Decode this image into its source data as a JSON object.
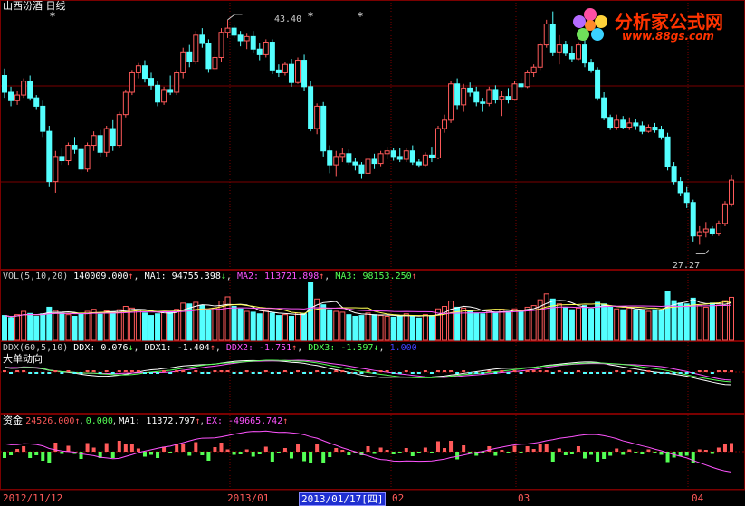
{
  "title": "山西汾酒 日线",
  "price_panel": {
    "high_label": "43.40",
    "low_label": "27.27",
    "star": "*"
  },
  "logo": {
    "name": "分析家公式网",
    "url": "www.88gs.com"
  },
  "vol_header": {
    "name": "VOL(5,10,20)",
    "value": "140009.000",
    "ma1": "MA1: 94755.398",
    "ma2": "MA2: 113721.898",
    "ma3": "MA3: 98153.250",
    "arrow_up": "↑",
    "arrow_down": "↓"
  },
  "ddx_header": {
    "name": "DDX(60,5,10)",
    "ddx": "DDX: 0.076",
    "ddx1": "DDX1: -1.404",
    "ddx2": "DDX2: -1.751",
    "ddx3": "DDX3: -1.597",
    "extra": "1.000",
    "subtitle": "大单动向"
  },
  "fund_header": {
    "name": "资金",
    "value": "24526.000",
    "zero": "0.000",
    "ma1": "MA1: 11372.797",
    "ex": "EX: -49665.742"
  },
  "dates": {
    "d1": "2012/11/12",
    "d2": "2013/01",
    "cursor": "2013/01/17",
    "cursor_weekday": "四",
    "d4": "02",
    "d5": "03",
    "d6": "04"
  },
  "colors": {
    "up": "#ff5a5a",
    "down": "#54ffff",
    "grid": "#7a0000",
    "white": "#ffffff",
    "yellow": "#ffff54",
    "magenta": "#ff54ff",
    "green": "#54ff54",
    "blue": "#4040ff"
  },
  "chart_data": {
    "type": "candlestick",
    "ohlc": [
      [
        39.4,
        39.9,
        37.8,
        38.2
      ],
      [
        38.2,
        38.6,
        37.2,
        37.6
      ],
      [
        37.6,
        38.3,
        37.3,
        38.0
      ],
      [
        38.0,
        39.2,
        37.8,
        39.0
      ],
      [
        39.0,
        39.4,
        37.6,
        37.8
      ],
      [
        37.8,
        38.0,
        37.0,
        37.2
      ],
      [
        37.2,
        37.6,
        35.0,
        35.4
      ],
      [
        35.4,
        35.8,
        31.4,
        31.8
      ],
      [
        31.8,
        34.0,
        31.0,
        33.6
      ],
      [
        33.6,
        34.2,
        33.0,
        33.3
      ],
      [
        33.3,
        34.6,
        33.0,
        34.4
      ],
      [
        34.4,
        35.0,
        33.8,
        34.1
      ],
      [
        34.1,
        34.5,
        32.4,
        32.7
      ],
      [
        32.7,
        34.6,
        32.5,
        34.4
      ],
      [
        34.4,
        35.4,
        34.0,
        35.1
      ],
      [
        35.1,
        35.5,
        33.6,
        33.9
      ],
      [
        33.9,
        35.8,
        33.6,
        35.6
      ],
      [
        35.6,
        36.2,
        34.0,
        34.4
      ],
      [
        34.4,
        36.8,
        34.2,
        36.6
      ],
      [
        36.6,
        38.4,
        36.4,
        38.2
      ],
      [
        38.2,
        39.8,
        38.0,
        39.6
      ],
      [
        39.6,
        40.3,
        39.2,
        40.1
      ],
      [
        40.1,
        40.5,
        38.9,
        39.2
      ],
      [
        39.2,
        39.6,
        38.4,
        38.7
      ],
      [
        38.7,
        39.0,
        37.2,
        37.5
      ],
      [
        37.5,
        38.6,
        37.3,
        38.4
      ],
      [
        38.4,
        39.4,
        38.0,
        38.2
      ],
      [
        38.2,
        39.8,
        38.0,
        39.6
      ],
      [
        39.6,
        41.4,
        39.2,
        41.1
      ],
      [
        41.1,
        41.6,
        40.0,
        40.4
      ],
      [
        40.4,
        42.6,
        40.2,
        42.3
      ],
      [
        42.3,
        42.8,
        41.4,
        41.7
      ],
      [
        41.7,
        42.0,
        39.6,
        39.9
      ],
      [
        39.9,
        41.2,
        39.8,
        40.7
      ],
      [
        40.7,
        42.8,
        40.4,
        42.5
      ],
      [
        42.5,
        43.4,
        42.1,
        42.8
      ],
      [
        42.8,
        43.0,
        42.1,
        42.3
      ],
      [
        42.3,
        42.6,
        41.5,
        41.9
      ],
      [
        41.9,
        42.4,
        41.3,
        42.2
      ],
      [
        42.2,
        42.6,
        41.0,
        41.3
      ],
      [
        41.3,
        41.7,
        40.5,
        40.9
      ],
      [
        40.9,
        42.0,
        40.7,
        41.8
      ],
      [
        41.8,
        42.0,
        39.5,
        39.8
      ],
      [
        39.8,
        40.2,
        39.3,
        39.6
      ],
      [
        39.6,
        40.4,
        39.4,
        40.2
      ],
      [
        40.2,
        40.6,
        38.6,
        38.9
      ],
      [
        38.9,
        40.7,
        38.8,
        40.5
      ],
      [
        40.5,
        40.9,
        38.3,
        38.6
      ],
      [
        38.6,
        39.0,
        35.4,
        35.6
      ],
      [
        35.6,
        37.4,
        35.2,
        37.2
      ],
      [
        37.2,
        37.5,
        33.6,
        34.0
      ],
      [
        34.0,
        34.4,
        32.4,
        33.0
      ],
      [
        33.0,
        34.0,
        32.2,
        33.6
      ],
      [
        33.6,
        34.2,
        33.2,
        33.8
      ],
      [
        33.8,
        34.1,
        33.0,
        33.2
      ],
      [
        33.2,
        33.5,
        32.6,
        33.0
      ],
      [
        33.0,
        33.2,
        32.0,
        32.4
      ],
      [
        32.4,
        33.6,
        32.2,
        33.4
      ],
      [
        33.4,
        33.8,
        32.7,
        33.1
      ],
      [
        33.1,
        34.0,
        32.9,
        33.8
      ],
      [
        33.8,
        34.3,
        33.4,
        34.0
      ],
      [
        34.0,
        34.2,
        33.3,
        33.6
      ],
      [
        33.6,
        34.2,
        33.2,
        33.4
      ],
      [
        33.4,
        34.2,
        33.2,
        34.0
      ],
      [
        34.0,
        34.4,
        33.0,
        33.2
      ],
      [
        33.2,
        33.4,
        32.8,
        33.0
      ],
      [
        33.0,
        33.9,
        32.9,
        33.7
      ],
      [
        33.7,
        34.3,
        33.2,
        33.5
      ],
      [
        33.5,
        35.8,
        33.4,
        35.6
      ],
      [
        35.6,
        36.6,
        35.3,
        36.2
      ],
      [
        36.2,
        39.0,
        36.0,
        38.8
      ],
      [
        38.8,
        39.2,
        37.0,
        37.3
      ],
      [
        37.3,
        38.8,
        36.8,
        38.5
      ],
      [
        38.5,
        38.9,
        37.9,
        38.2
      ],
      [
        38.2,
        38.6,
        37.2,
        37.5
      ],
      [
        37.5,
        37.8,
        36.8,
        37.4
      ],
      [
        37.4,
        38.6,
        37.2,
        38.4
      ],
      [
        38.4,
        38.7,
        37.4,
        37.7
      ],
      [
        37.7,
        38.3,
        36.5,
        37.9
      ],
      [
        37.9,
        38.5,
        37.4,
        37.7
      ],
      [
        37.7,
        39.0,
        37.6,
        38.8
      ],
      [
        38.8,
        39.2,
        38.4,
        38.6
      ],
      [
        38.6,
        39.8,
        38.5,
        39.6
      ],
      [
        39.6,
        40.2,
        39.3,
        40.0
      ],
      [
        40.0,
        41.8,
        39.8,
        41.6
      ],
      [
        41.6,
        43.4,
        41.4,
        43.1
      ],
      [
        43.1,
        44.0,
        40.8,
        41.1
      ],
      [
        41.1,
        42.3,
        40.2,
        41.6
      ],
      [
        41.6,
        41.9,
        40.8,
        41.0
      ],
      [
        41.0,
        41.5,
        40.4,
        40.6
      ],
      [
        40.6,
        41.8,
        40.5,
        41.6
      ],
      [
        41.6,
        42.0,
        40.0,
        40.3
      ],
      [
        40.3,
        40.6,
        39.6,
        39.8
      ],
      [
        39.8,
        40.0,
        37.6,
        37.8
      ],
      [
        37.8,
        38.2,
        36.2,
        36.4
      ],
      [
        36.4,
        36.6,
        35.5,
        35.7
      ],
      [
        35.7,
        36.6,
        35.5,
        36.2
      ],
      [
        36.2,
        36.5,
        35.6,
        35.7
      ],
      [
        35.7,
        36.4,
        35.5,
        36.0
      ],
      [
        36.0,
        36.3,
        35.5,
        35.8
      ],
      [
        35.8,
        36.1,
        35.2,
        35.4
      ],
      [
        35.4,
        35.9,
        35.3,
        35.7
      ],
      [
        35.7,
        36.0,
        35.3,
        35.5
      ],
      [
        35.5,
        35.8,
        34.8,
        35.0
      ],
      [
        35.0,
        35.3,
        32.6,
        32.9
      ],
      [
        32.9,
        33.2,
        31.6,
        31.8
      ],
      [
        31.8,
        32.1,
        30.8,
        31.0
      ],
      [
        31.0,
        31.4,
        29.9,
        30.3
      ],
      [
        30.3,
        30.5,
        27.5,
        27.9
      ],
      [
        27.9,
        28.6,
        27.27,
        28.2
      ],
      [
        28.2,
        28.9,
        27.8,
        28.4
      ],
      [
        28.4,
        28.6,
        27.9,
        28.1
      ],
      [
        28.1,
        29.0,
        27.9,
        28.8
      ],
      [
        28.8,
        30.4,
        28.6,
        30.2
      ],
      [
        30.2,
        32.3,
        30.0,
        31.9
      ]
    ],
    "volume": [
      60,
      55,
      62,
      70,
      65,
      58,
      64,
      80,
      72,
      66,
      62,
      58,
      65,
      70,
      75,
      63,
      71,
      68,
      74,
      82,
      78,
      72,
      66,
      60,
      64,
      70,
      68,
      75,
      90,
      88,
      92,
      85,
      72,
      78,
      95,
      105,
      82,
      76,
      70,
      68,
      64,
      72,
      66,
      60,
      62,
      58,
      66,
      64,
      140,
      100,
      86,
      74,
      70,
      68,
      62,
      58,
      60,
      66,
      62,
      60,
      58,
      56,
      60,
      64,
      58,
      54,
      62,
      60,
      76,
      82,
      95,
      80,
      78,
      70,
      66,
      64,
      72,
      68,
      75,
      70,
      76,
      72,
      80,
      84,
      98,
      112,
      100,
      88,
      80,
      74,
      78,
      84,
      76,
      92,
      88,
      80,
      76,
      74,
      78,
      74,
      72,
      70,
      74,
      72,
      118,
      96,
      90,
      88,
      102,
      84,
      80,
      90,
      85,
      96,
      104
    ],
    "vol_ma": [
      {
        "name": "MA1",
        "color": "#ffffff"
      },
      {
        "name": "MA2",
        "color": "#ffff54"
      },
      {
        "name": "MA3",
        "color": "#ff54ff"
      }
    ],
    "price_range": [
      26.0,
      44.3
    ],
    "xlabels": [
      "2012/11/12",
      "2013/01",
      "2013/01/17",
      "02",
      "03",
      "04"
    ]
  }
}
